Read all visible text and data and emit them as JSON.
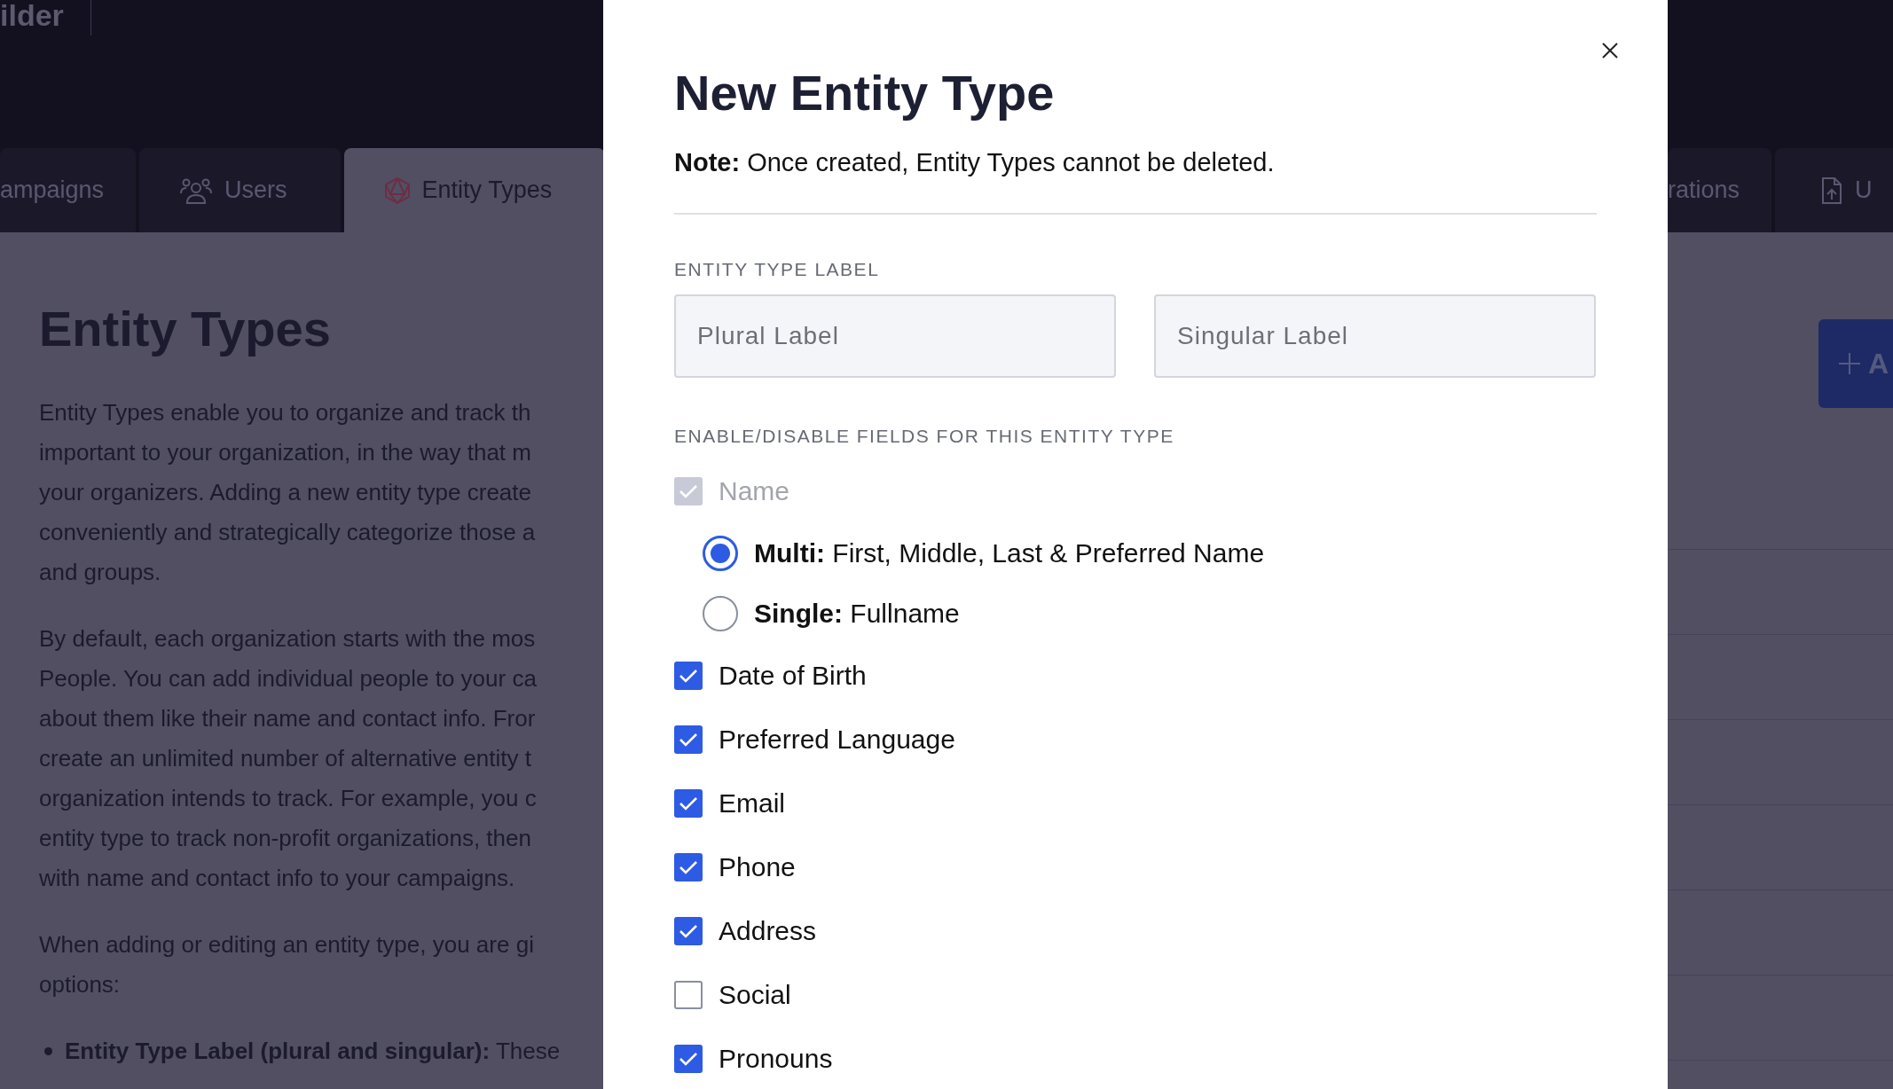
{
  "logo": "ilder",
  "tabs": [
    {
      "label": "ampaigns",
      "selected": false
    },
    {
      "label": "Users",
      "selected": false
    },
    {
      "label": "Entity Types",
      "selected": true
    }
  ],
  "right_tabs": [
    {
      "label": "rations",
      "selected": false
    },
    {
      "label": "U",
      "selected": false
    }
  ],
  "page": {
    "title": "Entity Types",
    "paragraphs": [
      [
        "Entity Types enable you to organize and track th",
        "important to your organization, in the way that m",
        "your organizers. Adding a new entity type create",
        "conveniently and strategically categorize those a",
        "and groups."
      ],
      [
        "By default, each organization starts with the mos",
        "People. You can add individual people to your ca",
        "about them like their name and contact info. Fror",
        "create an unlimited number of alternative entity t",
        "organization intends to track. For example, you c",
        "entity type to track non-profit organizations, then",
        "with name and contact info to your campaigns."
      ],
      [
        "When adding or editing an entity type, you are gi",
        "options:"
      ]
    ],
    "bullets": [
      "**Entity Type Label (plural and singular):** These"
    ]
  },
  "add_button": {
    "label": "A"
  },
  "modal": {
    "title": "New Entity Type",
    "note": "**Note:** Once created, Entity Types cannot be deleted.",
    "label_section": "ENTITY TYPE LABEL",
    "inputs": [
      {
        "placeholder": "Plural Label"
      },
      {
        "placeholder": "Singular Label"
      }
    ],
    "fields_section": "ENABLE/DISABLE FIELDS FOR THIS ENTITY TYPE",
    "fields": [
      {
        "kind": "checkbox",
        "label": "Name",
        "checked": true,
        "disabled": true
      },
      {
        "kind": "radio",
        "label": "**Multi:** First, Middle, Last & Preferred Name",
        "selected": true
      },
      {
        "kind": "radio",
        "label": "**Single:** Fullname",
        "selected": false
      },
      {
        "kind": "checkbox",
        "label": "Date of Birth",
        "checked": true,
        "disabled": false
      },
      {
        "kind": "checkbox",
        "label": "Preferred Language",
        "checked": true,
        "disabled": false
      },
      {
        "kind": "checkbox",
        "label": "Email",
        "checked": true,
        "disabled": false
      },
      {
        "kind": "checkbox",
        "label": "Phone",
        "checked": true,
        "disabled": false
      },
      {
        "kind": "checkbox",
        "label": "Address",
        "checked": true,
        "disabled": false
      },
      {
        "kind": "checkbox",
        "label": "Social",
        "checked": false,
        "disabled": false
      },
      {
        "kind": "checkbox",
        "label": "Pronouns",
        "checked": true,
        "disabled": false
      }
    ]
  }
}
